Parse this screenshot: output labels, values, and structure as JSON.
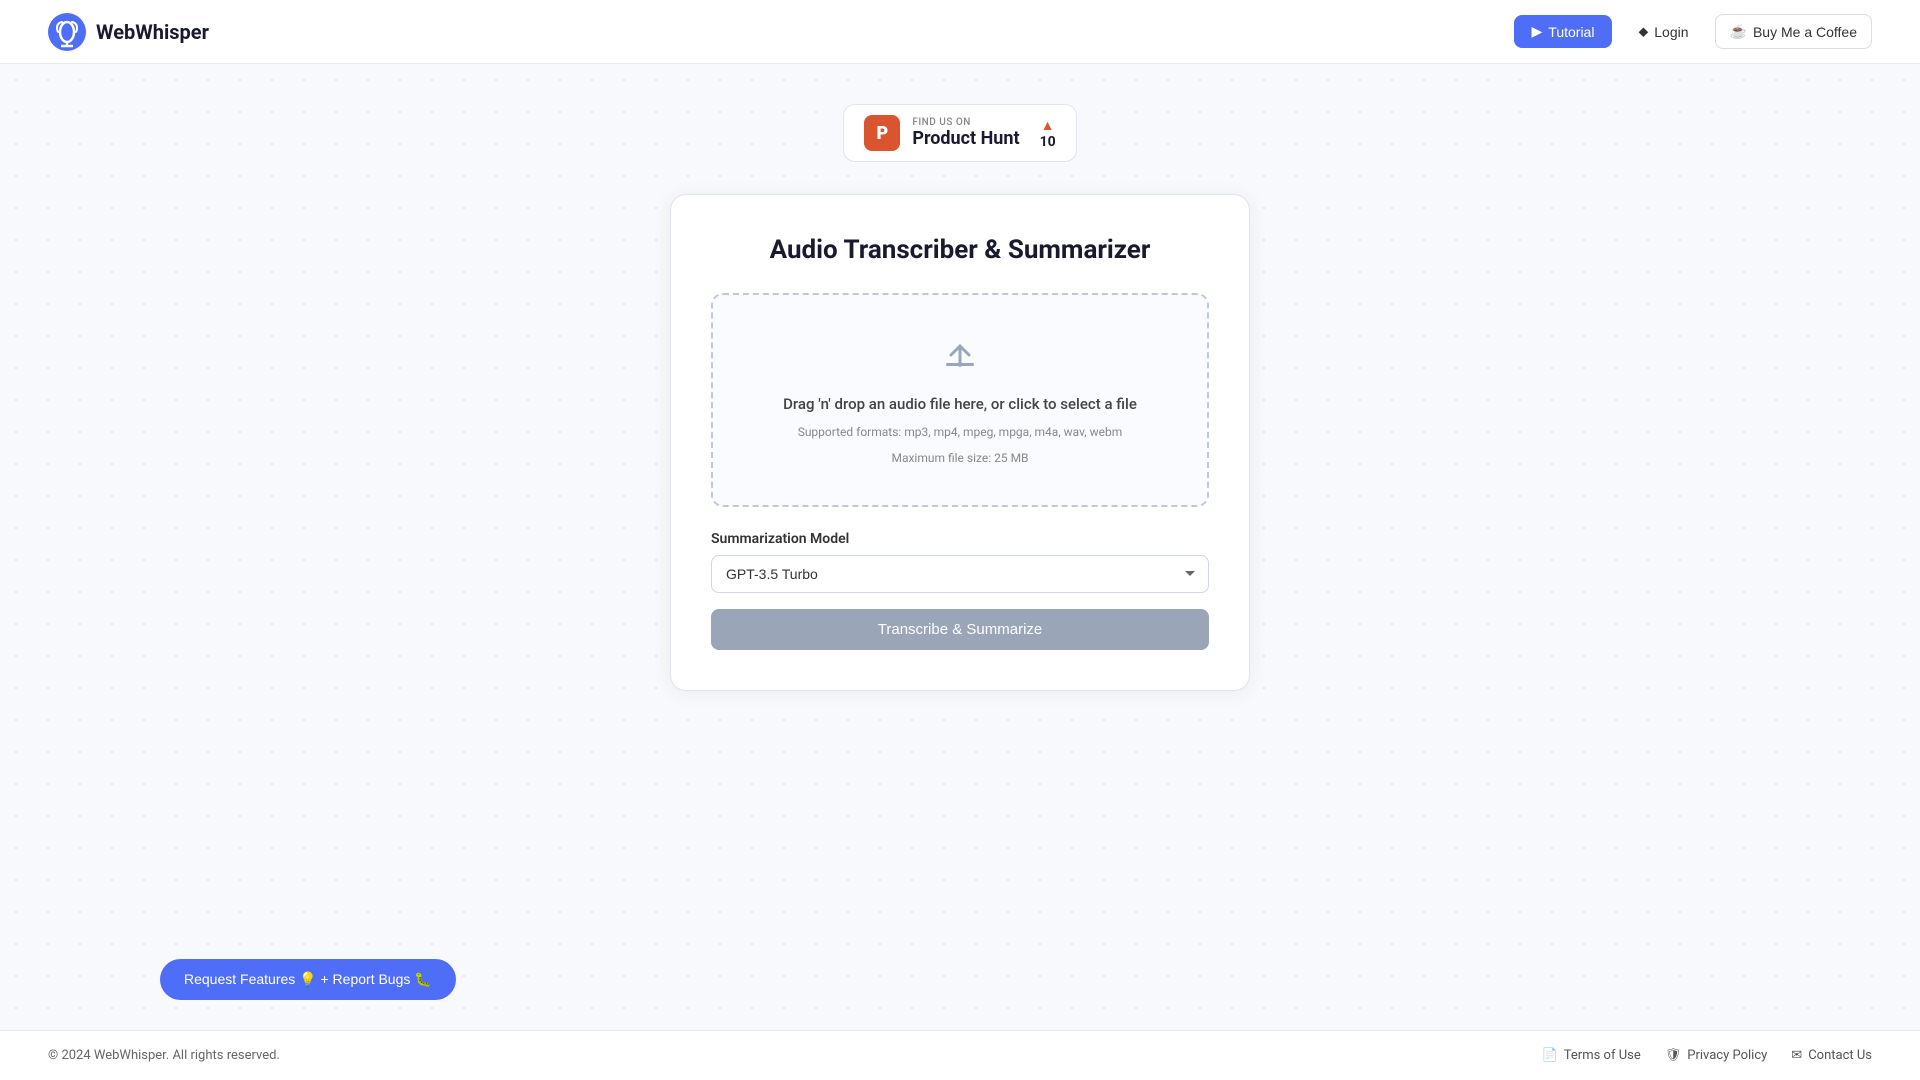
{
  "navbar": {
    "brand": "WebWhisper",
    "tutorial_label": "Tutorial",
    "login_label": "Login",
    "coffee_label": "Buy Me a Coffee"
  },
  "product_hunt": {
    "find_text": "FIND US ON",
    "name": "Product Hunt",
    "count": "10"
  },
  "card": {
    "title": "Audio Transcriber & Summarizer",
    "drop_main": "Drag 'n' drop an audio file here, or click to select a file",
    "formats": "Supported formats: mp3, mp4, mpeg, mpga, m4a, wav, webm",
    "max_size": "Maximum file size: 25 MB",
    "model_label": "Summarization Model",
    "model_value": "GPT-3.5 Turbo",
    "transcribe_label": "Transcribe & Summarize"
  },
  "floating": {
    "label": "Request Features 💡 + Report Bugs 🐛"
  },
  "footer": {
    "copy": "© 2024 WebWhisper. All rights reserved.",
    "terms_label": "Terms of Use",
    "privacy_label": "Privacy Policy",
    "contact_label": "Contact Us"
  },
  "icons": {
    "play_icon": "▶",
    "login_icon": "→",
    "coffee_icon": "☕",
    "info_icon": "ℹ",
    "document_icon": "📄",
    "shield_icon": "🛡",
    "mail_icon": "✉"
  }
}
